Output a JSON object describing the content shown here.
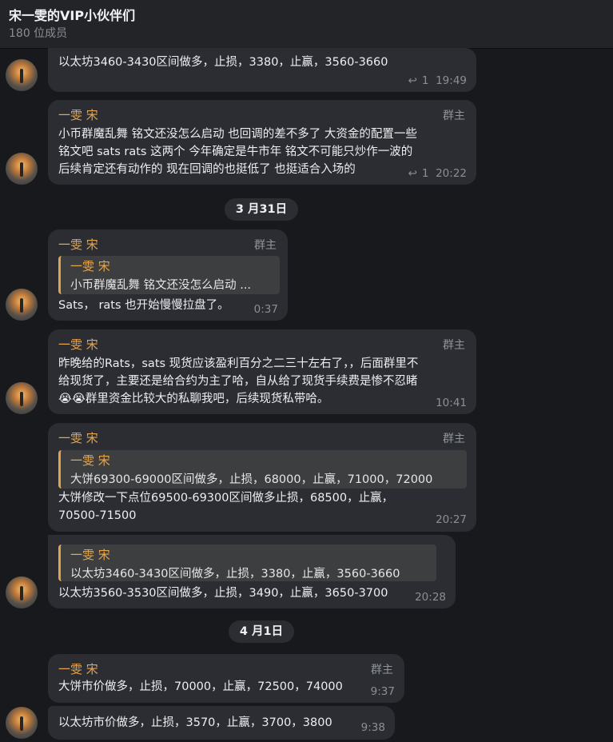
{
  "header": {
    "title": "宋一雯的VIP小伙伴们",
    "members": "180 位成员"
  },
  "messages": [
    {
      "text": "以太坊3460-3430区间做多，止损，3380，止赢，3560-3660",
      "reply_count": "1",
      "time": "19:49"
    },
    {
      "sender": "一雯 宋",
      "role": "群主",
      "lines": [
        "小币群魔乱舞 铭文还没怎么启动 也回调的差不多了  大资金的配置一些",
        "铭文吧  sats  rats  这两个   今年确定是牛市年  铭文不可能只炒作一波的",
        "后续肯定还有动作的 现在回调的也挺低了 也挺适合入场的"
      ],
      "reply_count": "1",
      "time": "20:22"
    },
    {
      "sender": "一雯 宋",
      "role": "群主",
      "quote_sender": "一雯 宋",
      "quote_text": "小币群魔乱舞 铭文还没怎么启动 ...",
      "text": "Sats， rats 也开始慢慢拉盘了。",
      "time": "0:37"
    },
    {
      "sender": "一雯 宋",
      "role": "群主",
      "lines": [
        "昨晚给的Rats，sats 现货应该盈利百分之二三十左右了，，后面群里不",
        "给现货了，主要还是给合约为主了哈，自从给了现货手续费是惨不忍睹",
        "😭😭群里资金比较大的私聊我吧，后续现货私带哈。"
      ],
      "time": "10:41"
    },
    {
      "sender": "一雯 宋",
      "role": "群主",
      "quote_sender": "一雯 宋",
      "quote_text": "大饼69300-69000区间做多，止损，68000，止赢，71000，72000",
      "lines": [
        "大饼修改一下点位69500-69300区间做多止损，68500，止赢，",
        "70500-71500"
      ],
      "time": "20:27"
    },
    {
      "quote_sender": "一雯 宋",
      "quote_text": "以太坊3460-3430区间做多，止损，3380，止赢，3560-3660",
      "text": "以太坊3560-3530区间做多，止损，3490，止赢，3650-3700",
      "time": "20:28"
    },
    {
      "sender": "一雯 宋",
      "role": "群主",
      "text": "大饼市价做多，止损，70000，止赢，72500，74000",
      "time": "9:37"
    },
    {
      "text": "以太坊市价做多，止损，3570，止赢，3700，3800",
      "time": "9:38"
    }
  ],
  "dates": [
    "3 月31日",
    "4 月1日"
  ]
}
